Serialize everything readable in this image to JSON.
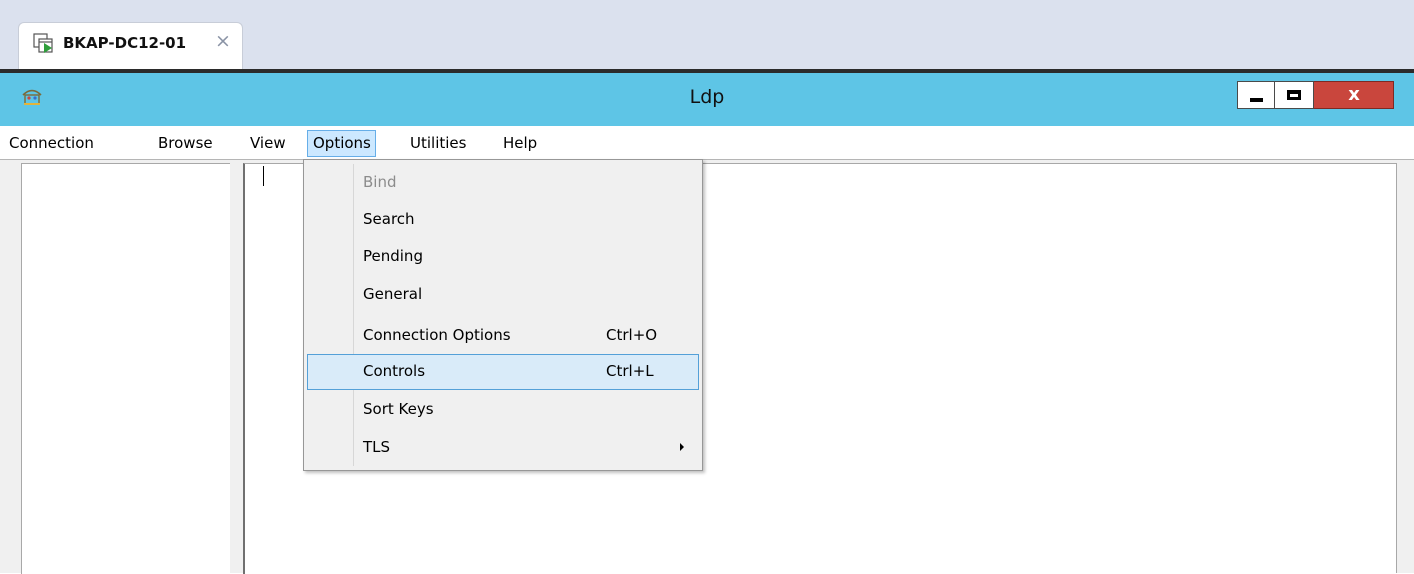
{
  "host_tab": {
    "title": "BKAP-DC12-01",
    "close_glyph": "×",
    "icon": "remote-desktop-icon"
  },
  "window": {
    "title": "Ldp",
    "app_icon": "ldp-app-icon",
    "close_glyph": "x"
  },
  "menubar": {
    "items": [
      "Connection",
      "Browse",
      "View",
      "Options",
      "Utilities",
      "Help"
    ],
    "open_item": "Options"
  },
  "options_menu": {
    "items": [
      {
        "label": "Bind",
        "shortcut": "",
        "enabled": false
      },
      {
        "label": "Search",
        "shortcut": ""
      },
      {
        "label": "Pending",
        "shortcut": ""
      },
      {
        "label": "General",
        "shortcut": ""
      },
      {
        "label": "Connection Options",
        "shortcut": "Ctrl+O"
      },
      {
        "label": "Controls",
        "shortcut": "Ctrl+L",
        "highlighted": true
      },
      {
        "label": "Sort Keys",
        "shortcut": ""
      },
      {
        "label": "TLS",
        "shortcut": "",
        "submenu": true
      }
    ]
  },
  "colors": {
    "titlebar": "#5ec5e6",
    "close_button": "#c9463d",
    "tabstrip": "#dbe1ee",
    "menu_highlight": "#d9ebf9"
  }
}
